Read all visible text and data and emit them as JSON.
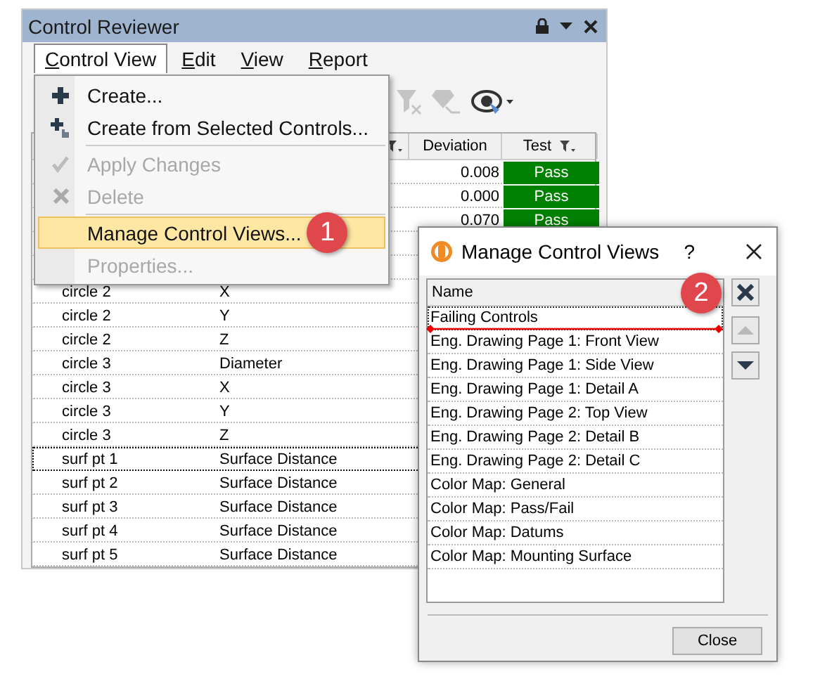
{
  "panel": {
    "title": "Control Reviewer"
  },
  "menubar": [
    {
      "label": "Control View",
      "selected": true
    },
    {
      "label": "Edit",
      "selected": false
    },
    {
      "label": "View",
      "selected": false
    },
    {
      "label": "Report",
      "selected": false
    }
  ],
  "toolbar": [
    {
      "kind": "filter-clear",
      "disabled": true
    },
    {
      "kind": "network",
      "disabled": true
    },
    {
      "kind": "eye",
      "disabled": false
    }
  ],
  "table": {
    "columns": [
      {},
      {
        "filter": true
      },
      {
        "label": "Deviation"
      },
      {
        "label": "Test",
        "filter": true
      }
    ],
    "rows": [
      {
        "deviation": "0.008",
        "test": "Pass",
        "focused": false
      },
      {
        "deviation": "0.000",
        "test": "Pass",
        "focused": false
      },
      {
        "deviation": "0.070",
        "test": "Pass",
        "focused": false
      },
      {
        "focused": false
      },
      {
        "focused": false
      },
      {
        "name": "circle 2",
        "property": "X",
        "focused": false
      },
      {
        "name": "circle 2",
        "property": "Y",
        "focused": false
      },
      {
        "name": "circle 2",
        "property": "Z",
        "focused": false
      },
      {
        "name": "circle 3",
        "property": "Diameter",
        "focused": false
      },
      {
        "name": "circle 3",
        "property": "X",
        "focused": false
      },
      {
        "name": "circle 3",
        "property": "Y",
        "focused": false
      },
      {
        "name": "circle 3",
        "property": "Z",
        "focused": false
      },
      {
        "name": "surf pt 1",
        "property": "Surface Distance",
        "focused": true
      },
      {
        "name": "surf pt 2",
        "property": "Surface Distance",
        "focused": false
      },
      {
        "name": "surf pt 3",
        "property": "Surface Distance",
        "focused": false
      },
      {
        "name": "surf pt 4",
        "property": "Surface Distance",
        "focused": false
      },
      {
        "name": "surf pt 5",
        "property": "Surface Distance",
        "focused": false
      }
    ]
  },
  "menu": {
    "items": [
      {
        "kind": "item",
        "label": "Create...",
        "disabled": false,
        "selected": false
      },
      {
        "kind": "item",
        "label": "Create from Selected Controls...",
        "disabled": false,
        "selected": false
      },
      {
        "kind": "separator"
      },
      {
        "kind": "item",
        "label": "Apply Changes",
        "disabled": true,
        "selected": false
      },
      {
        "kind": "item",
        "label": "Delete",
        "disabled": true,
        "selected": false
      },
      {
        "kind": "separator"
      },
      {
        "kind": "item",
        "label": "Manage Control Views...",
        "disabled": false,
        "selected": true,
        "callout": "1"
      },
      {
        "kind": "item",
        "label": "Properties...",
        "disabled": true,
        "selected": false
      }
    ]
  },
  "dialog": {
    "title": "Manage Control Views",
    "help": "?",
    "list_header": "Name",
    "callout": "2",
    "items": [
      {
        "label": "Failing Controls",
        "focused": true,
        "drop_target": true
      },
      {
        "label": "Eng. Drawing Page 1: Front View",
        "focused": false,
        "drop_target": false
      },
      {
        "label": "Eng. Drawing Page 1: Side View",
        "focused": false,
        "drop_target": false
      },
      {
        "label": "Eng. Drawing Page 1: Detail A",
        "focused": false,
        "drop_target": false
      },
      {
        "label": "Eng. Drawing Page 2: Top View",
        "focused": false,
        "drop_target": false
      },
      {
        "label": "Eng. Drawing Page 2: Detail B",
        "focused": false,
        "drop_target": false
      },
      {
        "label": "Eng. Drawing Page 2: Detail C",
        "focused": false,
        "drop_target": false
      },
      {
        "label": "Color Map: General",
        "focused": false,
        "drop_target": false
      },
      {
        "label": "Color Map: Pass/Fail",
        "focused": false,
        "drop_target": false
      },
      {
        "label": "Color Map: Datums",
        "focused": false,
        "drop_target": false
      },
      {
        "label": "Color Map: Mounting Surface",
        "focused": false,
        "drop_target": false
      }
    ],
    "side_buttons": [
      {
        "kind": "delete",
        "disabled": false
      },
      {
        "kind": "up",
        "disabled": true
      },
      {
        "kind": "down",
        "disabled": false
      }
    ],
    "close_button": "Close"
  }
}
